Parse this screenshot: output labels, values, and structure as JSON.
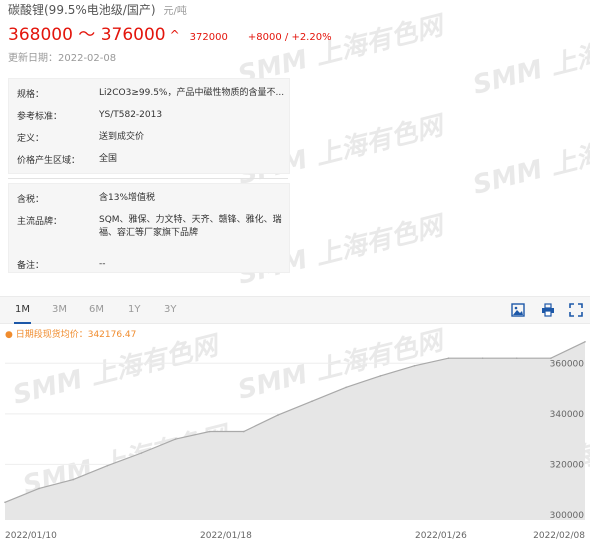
{
  "header": {
    "title": "碳酸锂(99.5%电池级/国产)",
    "unit": "元/吨",
    "price_range": "368000 ～ 376000",
    "arrow": "^",
    "price_mid": "372000",
    "change_abs": "+8000",
    "change_sep": "/",
    "change_pct": "+2.20%",
    "updated": "更新日期：2022-02-08"
  },
  "spec": {
    "block1": [
      {
        "label": "规格：",
        "value": "Li2CO3≥99.5%，产品中磁性物质的含量不..."
      },
      {
        "label": "参考标准：",
        "value": "YS/T582-2013"
      },
      {
        "label": "定义：",
        "value": "送到成交价"
      },
      {
        "label": "价格产生区域：",
        "value": "全国"
      }
    ],
    "block2": [
      {
        "label": "含税：",
        "value": "含13%增值税"
      },
      {
        "label": "主流品牌：",
        "value": "SQM、雅保、力文特、天齐、赣锋、雅化、瑞福、容汇等厂家旗下品牌"
      },
      {
        "label": "备注：",
        "value": "--"
      }
    ]
  },
  "toolbar": {
    "tabs": [
      "1M",
      "3M",
      "6M",
      "1Y",
      "3Y"
    ],
    "active": "1M",
    "icons": [
      "picture-icon",
      "print-icon",
      "fullscreen-icon"
    ]
  },
  "watermark": "SMM 上海有色网",
  "colors": {
    "price_red": "#e3150c",
    "avg_orange": "#f08c2e",
    "tab_underline": "#1d58a8",
    "line": "#a9a9a9"
  },
  "chart_data": {
    "type": "area",
    "title": "",
    "legend": "日期段现货均价：342176.47",
    "x_ticks": [
      "2022/01/10",
      "2022/01/18",
      "2022/01/26",
      "2022/02/08"
    ],
    "y_ticks": [
      "300000",
      "320000",
      "340000",
      "360000"
    ],
    "ylim": [
      298000,
      370000
    ],
    "y_values": [
      305000,
      310500,
      314000,
      319500,
      324500,
      330000,
      333000,
      333000,
      339500,
      345000,
      350500,
      355000,
      359000,
      362000,
      362000,
      362000,
      362000,
      368500
    ],
    "grid": true
  }
}
